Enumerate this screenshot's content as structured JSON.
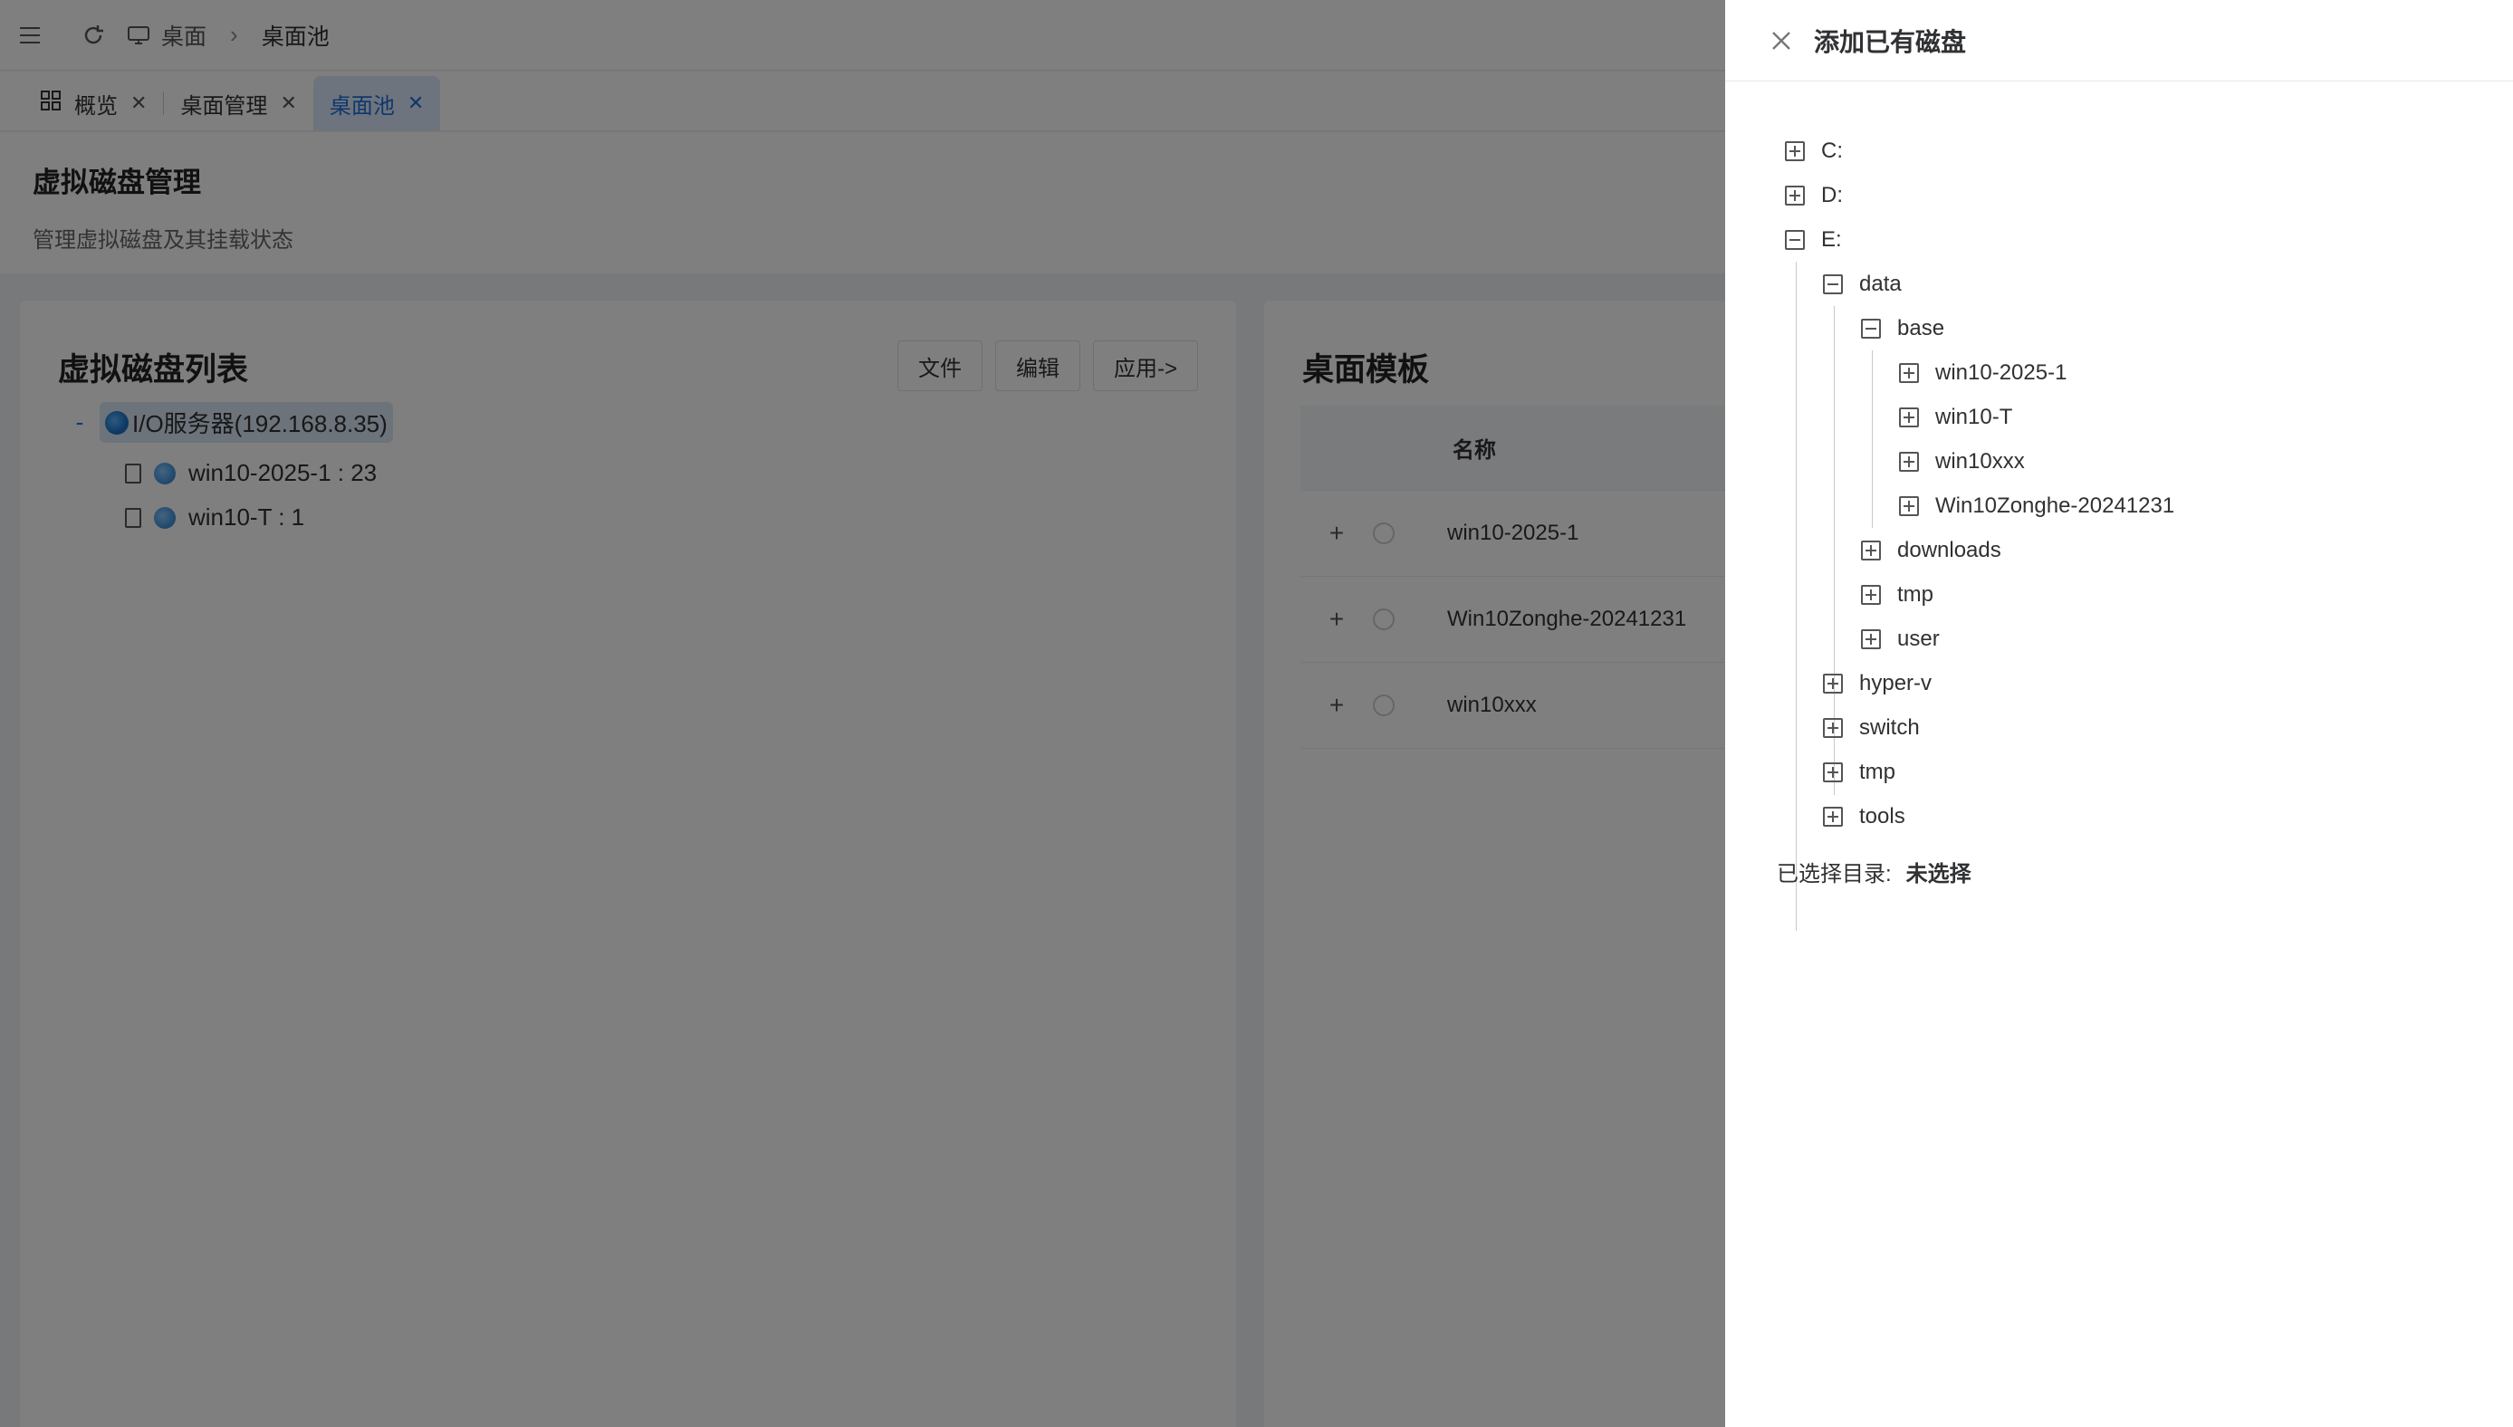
{
  "topbar": {
    "breadcrumb": [
      "桌面",
      "桌面池"
    ]
  },
  "tabs": [
    {
      "label": "概览",
      "active": false
    },
    {
      "label": "桌面管理",
      "active": false
    },
    {
      "label": "桌面池",
      "active": true
    }
  ],
  "page": {
    "title": "虚拟磁盘管理",
    "subtitle": "管理虚拟磁盘及其挂载状态"
  },
  "disk_list": {
    "title": "虚拟磁盘列表",
    "buttons": [
      "文件",
      "编辑",
      "应用->"
    ],
    "root_toggle": "-",
    "root": "I/O服务器(192.168.8.35)",
    "items": [
      "win10-2025-1 : 23",
      "win10-T : 1"
    ]
  },
  "templates": {
    "title": "桌面模板",
    "column_name": "名称",
    "row_toggle": "+",
    "rows": [
      "win10-2025-1",
      "Win10Zonghe-20241231",
      "win10xxx"
    ]
  },
  "drawer": {
    "title": "添加已有磁盘",
    "tree": [
      {
        "label": "C:",
        "expanded": false
      },
      {
        "label": "D:",
        "expanded": false
      },
      {
        "label": "E:",
        "expanded": true
      },
      {
        "label": "data",
        "expanded": true
      },
      {
        "label": "base",
        "expanded": true
      },
      {
        "label": "win10-2025-1",
        "expanded": false
      },
      {
        "label": "win10-T",
        "expanded": false
      },
      {
        "label": "win10xxx",
        "expanded": false
      },
      {
        "label": "Win10Zonghe-20241231",
        "expanded": false
      },
      {
        "label": "downloads",
        "expanded": false
      },
      {
        "label": "tmp",
        "expanded": false
      },
      {
        "label": "user",
        "expanded": false
      },
      {
        "label": "hyper-v",
        "expanded": false
      },
      {
        "label": "switch",
        "expanded": false
      },
      {
        "label": "tmp",
        "expanded": false
      },
      {
        "label": "tools",
        "expanded": false
      }
    ],
    "selected_label": "已选择目录:",
    "selected_value": "未选择"
  },
  "colors": {
    "accent": "#1e6fd9",
    "active_tab_bg": "#dbe9fb",
    "mask": "rgba(0,0,0,0.5)"
  }
}
